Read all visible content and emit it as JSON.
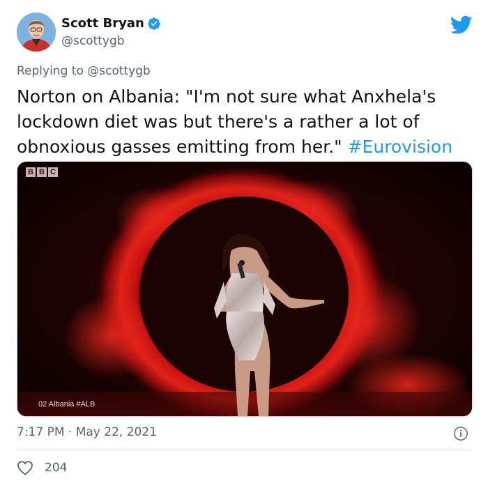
{
  "author": {
    "display_name": "Scott Bryan",
    "handle": "@scottygb",
    "verified": true
  },
  "reply": {
    "prefix": "Replying to",
    "mention": "@scottygb"
  },
  "tweet": {
    "text": "Norton on Albania: \"I'm not sure what Anxhela's lockdown diet was but there's a rather a lot of obnoxious gasses emitting from her.\"",
    "hashtag": "#Eurovision"
  },
  "media": {
    "broadcaster": [
      "B",
      "B",
      "C"
    ],
    "caption": "02 Albania #ALB"
  },
  "meta": {
    "timestamp": "7:17 PM · May 22, 2021",
    "likes": "204"
  },
  "colors": {
    "accent": "#1d9bf0",
    "secondary_text": "#536471"
  },
  "icons": [
    "verified-badge-icon",
    "twitter-bird-icon",
    "info-icon",
    "heart-icon"
  ]
}
